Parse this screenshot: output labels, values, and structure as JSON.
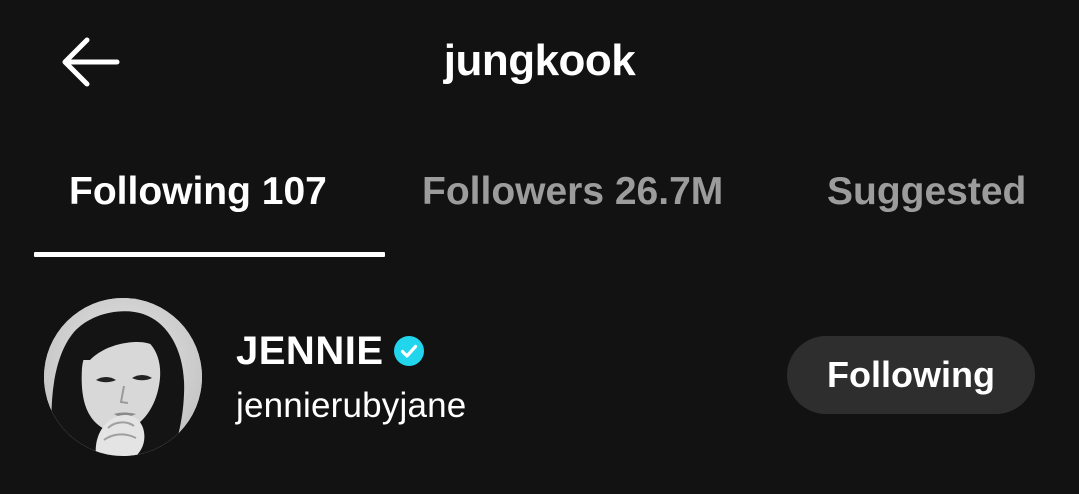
{
  "header": {
    "title": "jungkook",
    "back_icon": "arrow-left-icon"
  },
  "tabs": [
    {
      "label": "Following 107",
      "active": true
    },
    {
      "label": "Followers 26.7M",
      "active": false
    },
    {
      "label": "Suggested",
      "active": false
    }
  ],
  "list": {
    "items": [
      {
        "display_name": "JENNIE",
        "verified": true,
        "verified_icon": "verified-badge-icon",
        "username": "jennierubyjane",
        "avatar_icon": "profile-photo",
        "button_label": "Following"
      }
    ]
  },
  "colors": {
    "background": "#121212",
    "text_primary": "#ffffff",
    "text_inactive": "#9c9c9c",
    "verified": "#20d5ec",
    "button_bg": "#2e2e2e"
  }
}
